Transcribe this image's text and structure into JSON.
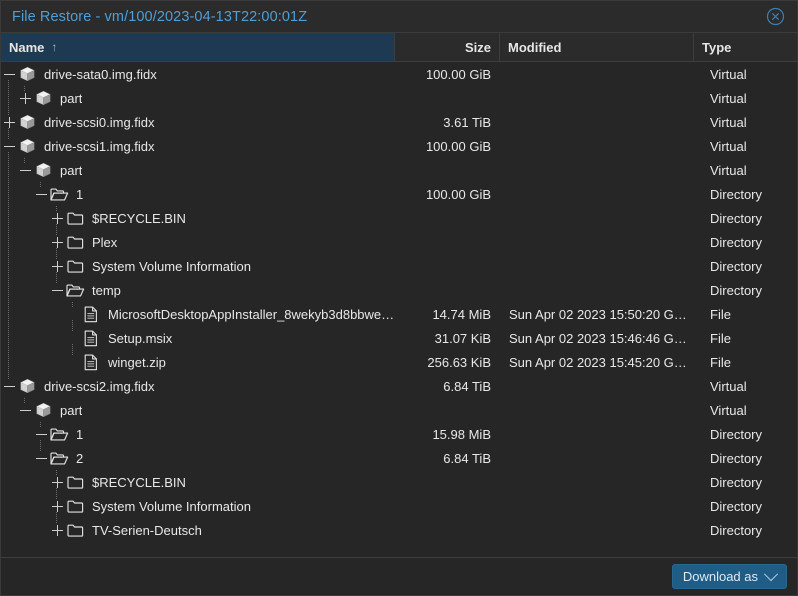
{
  "window": {
    "title": "File Restore - vm/100/2023-04-13T22:00:01Z",
    "close_icon": "close-circle-icon"
  },
  "colors": {
    "background": "#262626",
    "titlebar": "#2b2b2b",
    "title_text": "#4c9fd8",
    "header_sorted": "#1e3a52",
    "accent_button": "#1f5c86",
    "text": "#e8e8e8",
    "tree_guide": "#6d6d6d"
  },
  "table": {
    "columns": [
      {
        "key": "name",
        "label": "Name",
        "sorted": true,
        "sort_arrow": "↑",
        "align": "left"
      },
      {
        "key": "size",
        "label": "Size",
        "sorted": false,
        "sort_arrow": "",
        "align": "right"
      },
      {
        "key": "modified",
        "label": "Modified",
        "sorted": false,
        "sort_arrow": "",
        "align": "left"
      },
      {
        "key": "type",
        "label": "Type",
        "sorted": false,
        "sort_arrow": "",
        "align": "left"
      }
    ],
    "rows": [
      {
        "depth": 0,
        "expander": "minus",
        "icon": "virtual-drive-icon",
        "name": "drive-sata0.img.fidx",
        "size": "100.00 GiB",
        "modified": "",
        "type": "Virtual"
      },
      {
        "depth": 1,
        "expander": "plus",
        "icon": "virtual-drive-icon",
        "name": "part",
        "size": "",
        "modified": "",
        "type": "Virtual"
      },
      {
        "depth": 0,
        "expander": "plus",
        "icon": "virtual-drive-icon",
        "name": "drive-scsi0.img.fidx",
        "size": "3.61 TiB",
        "modified": "",
        "type": "Virtual"
      },
      {
        "depth": 0,
        "expander": "minus",
        "icon": "virtual-drive-icon",
        "name": "drive-scsi1.img.fidx",
        "size": "100.00 GiB",
        "modified": "",
        "type": "Virtual"
      },
      {
        "depth": 1,
        "expander": "minus",
        "icon": "virtual-drive-icon",
        "name": "part",
        "size": "",
        "modified": "",
        "type": "Virtual"
      },
      {
        "depth": 2,
        "expander": "minus",
        "icon": "folder-open-icon",
        "name": "1",
        "size": "100.00 GiB",
        "modified": "",
        "type": "Directory"
      },
      {
        "depth": 3,
        "expander": "plus",
        "icon": "folder-closed-icon",
        "name": "$RECYCLE.BIN",
        "size": "",
        "modified": "",
        "type": "Directory"
      },
      {
        "depth": 3,
        "expander": "plus",
        "icon": "folder-closed-icon",
        "name": "Plex",
        "size": "",
        "modified": "",
        "type": "Directory"
      },
      {
        "depth": 3,
        "expander": "plus",
        "icon": "folder-closed-icon",
        "name": "System Volume Information",
        "size": "",
        "modified": "",
        "type": "Directory"
      },
      {
        "depth": 3,
        "expander": "minus",
        "icon": "folder-open-icon",
        "name": "temp",
        "size": "",
        "modified": "",
        "type": "Directory"
      },
      {
        "depth": 4,
        "expander": "none",
        "icon": "file-icon",
        "name": "MicrosoftDesktopAppInstaller_8wekyb3d8bbwe…",
        "size": "14.74 MiB",
        "modified": "Sun Apr 02 2023 15:50:20 G…",
        "type": "File"
      },
      {
        "depth": 4,
        "expander": "none",
        "icon": "file-icon",
        "name": "Setup.msix",
        "size": "31.07 KiB",
        "modified": "Sun Apr 02 2023 15:46:46 G…",
        "type": "File"
      },
      {
        "depth": 4,
        "expander": "none",
        "icon": "file-icon",
        "name": "winget.zip",
        "size": "256.63 KiB",
        "modified": "Sun Apr 02 2023 15:45:20 G…",
        "type": "File"
      },
      {
        "depth": 0,
        "expander": "minus",
        "icon": "virtual-drive-icon",
        "name": "drive-scsi2.img.fidx",
        "size": "6.84 TiB",
        "modified": "",
        "type": "Virtual"
      },
      {
        "depth": 1,
        "expander": "minus",
        "icon": "virtual-drive-icon",
        "name": "part",
        "size": "",
        "modified": "",
        "type": "Virtual"
      },
      {
        "depth": 2,
        "expander": "minus",
        "icon": "folder-open-icon",
        "name": "1",
        "size": "15.98 MiB",
        "modified": "",
        "type": "Directory"
      },
      {
        "depth": 2,
        "expander": "minus",
        "icon": "folder-open-icon",
        "name": "2",
        "size": "6.84 TiB",
        "modified": "",
        "type": "Directory"
      },
      {
        "depth": 3,
        "expander": "plus",
        "icon": "folder-closed-icon",
        "name": "$RECYCLE.BIN",
        "size": "",
        "modified": "",
        "type": "Directory"
      },
      {
        "depth": 3,
        "expander": "plus",
        "icon": "folder-closed-icon",
        "name": "System Volume Information",
        "size": "",
        "modified": "",
        "type": "Directory"
      },
      {
        "depth": 3,
        "expander": "plus",
        "icon": "folder-closed-icon",
        "name": "TV-Serien-Deutsch",
        "size": "",
        "modified": "",
        "type": "Directory"
      }
    ]
  },
  "footer": {
    "download_label": "Download as",
    "download_icon": "chevron-down-icon"
  }
}
